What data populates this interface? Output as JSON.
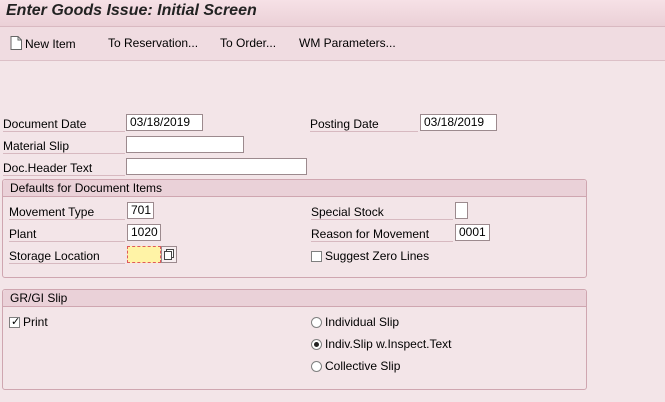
{
  "window": {
    "title": "Enter Goods Issue: Initial Screen"
  },
  "toolbar": {
    "new_item": "New Item",
    "to_reservation": "To Reservation...",
    "to_order": "To Order...",
    "wm_parameters": "WM Parameters..."
  },
  "header": {
    "document_date_label": "Document Date",
    "document_date_value": "03/18/2019",
    "posting_date_label": "Posting Date",
    "posting_date_value": "03/18/2019",
    "material_slip_label": "Material Slip",
    "material_slip_value": "",
    "doc_header_text_label": "Doc.Header Text",
    "doc_header_text_value": ""
  },
  "defaults": {
    "title": "Defaults for Document Items",
    "movement_type_label": "Movement Type",
    "movement_type_value": "701",
    "plant_label": "Plant",
    "plant_value": "1020",
    "storage_location_label": "Storage Location",
    "storage_location_value": "",
    "special_stock_label": "Special Stock",
    "special_stock_value": "",
    "reason_label": "Reason for Movement",
    "reason_value": "0001",
    "suggest_zero_label": "Suggest Zero Lines",
    "suggest_zero_checked": false
  },
  "slip": {
    "title": "GR/GI Slip",
    "print_label": "Print",
    "print_checked": true,
    "options": [
      "Individual Slip",
      "Indiv.Slip w.Inspect.Text",
      "Collective Slip"
    ],
    "selected_option": "Indiv.Slip w.Inspect.Text"
  }
}
